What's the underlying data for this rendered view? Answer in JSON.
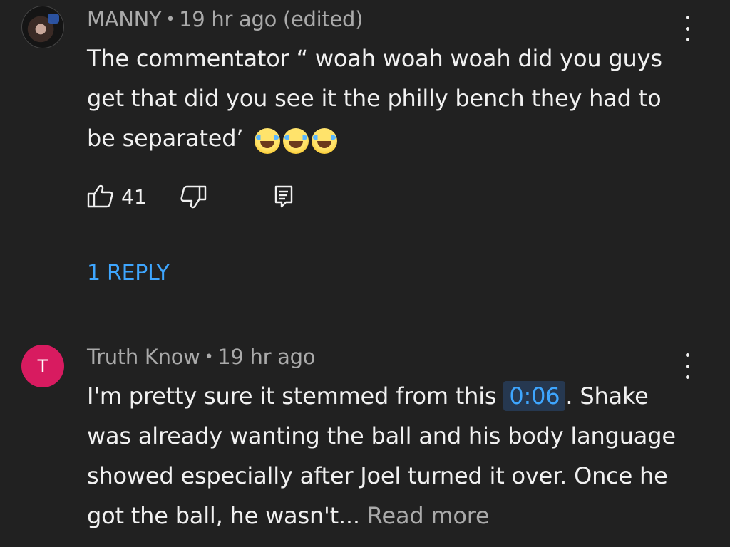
{
  "comments": [
    {
      "author": "MANNY",
      "time": "19 hr ago (edited)",
      "text": "The commentator “ woah woah woah did you guys get that did you see it the philly bench they had to be separated’",
      "emoji": [
        "😂",
        "😂",
        "😂"
      ],
      "likes": "41",
      "replies_label": "1 REPLY",
      "avatar": "user-photo"
    },
    {
      "author": "Truth Know",
      "time": "19 hr ago",
      "avatar_letter": "T",
      "avatar_color": "#d81b60",
      "text_before": "I'm pretty sure it stemmed from this",
      "timestamp": "0:06",
      "text_after": ". Shake was already wanting the ball and his body language showed especially after Joel turned it over. Once he got the ball, he wasn't...",
      "read_more": "Read more"
    }
  ],
  "icons": {
    "like": "thumbs-up-icon",
    "dislike": "thumbs-down-icon",
    "reply": "reply-icon",
    "more": "more-vert-icon"
  },
  "colors": {
    "background": "#212121",
    "text": "#f1f1f1",
    "secondary": "#aaaaaa",
    "link": "#3ea6ff"
  }
}
